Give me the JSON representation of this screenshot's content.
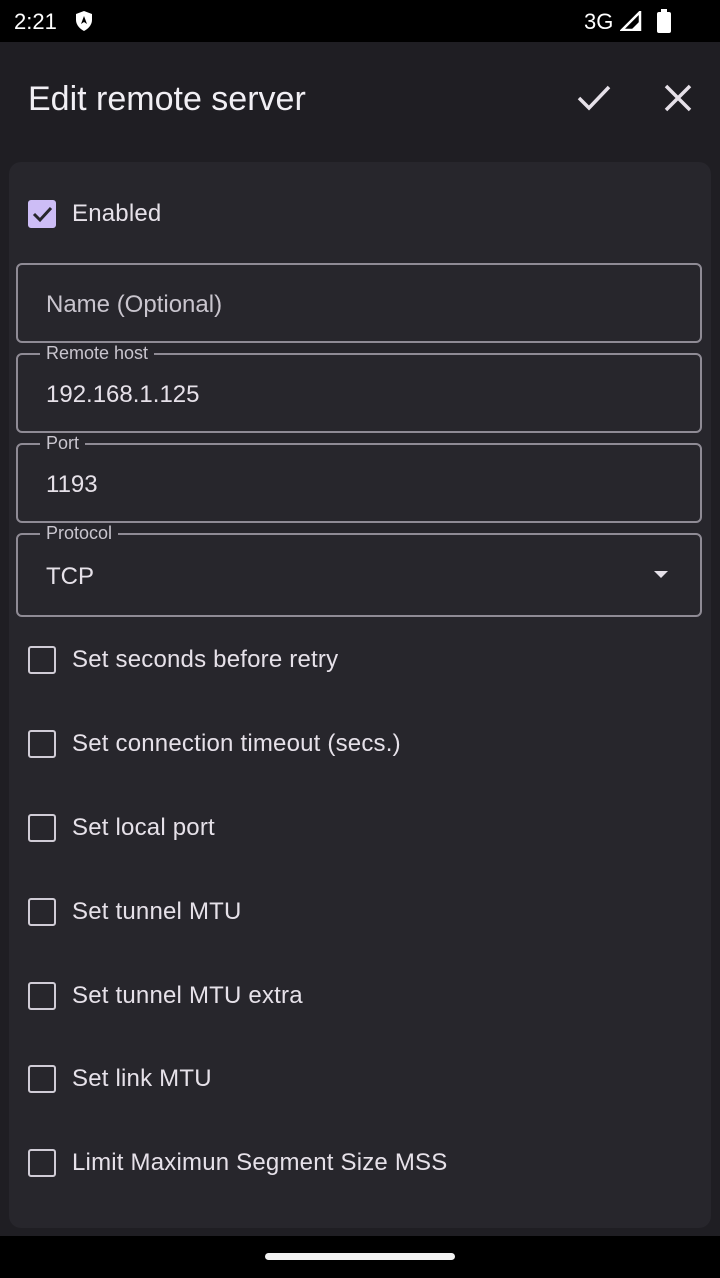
{
  "status_bar": {
    "time": "2:21",
    "network": "3G"
  },
  "app_bar": {
    "title": "Edit remote server"
  },
  "enabled": {
    "label": "Enabled",
    "checked": true
  },
  "fields": {
    "name": {
      "placeholder": "Name (Optional)"
    },
    "remote_host": {
      "label": "Remote host",
      "value": "192.168.1.125"
    },
    "port": {
      "label": "Port",
      "value": "1193"
    },
    "protocol": {
      "label": "Protocol",
      "value": "TCP"
    }
  },
  "options": [
    {
      "label": "Set seconds before retry",
      "checked": false
    },
    {
      "label": "Set connection timeout (secs.)",
      "checked": false
    },
    {
      "label": "Set local port",
      "checked": false
    },
    {
      "label": "Set tunnel MTU",
      "checked": false
    },
    {
      "label": "Set tunnel MTU extra",
      "checked": false
    },
    {
      "label": "Set link MTU",
      "checked": false
    },
    {
      "label": "Limit Maximun Segment Size MSS",
      "checked": false
    }
  ],
  "colors": {
    "accent": "#cdbdf6",
    "background": "#1f1e23",
    "card": "#27262c"
  }
}
